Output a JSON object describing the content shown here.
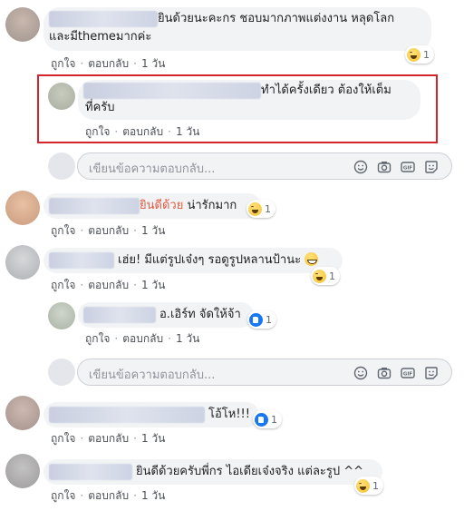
{
  "comments": [
    {
      "text_1": "ยินด้วยนะคะกร ชอบมากภาพแต่งงาน หลุดโลก",
      "text_2": "และมีthemeมากค่ะ",
      "like": "ถูกใจ",
      "reply": "ตอบกลับ",
      "time": "1 วัน",
      "reaction_count": "1"
    },
    {
      "text_1": "ทำได้ครั้งเดียว ต้องให้เต็ม",
      "text_2": "ที่ครับ",
      "like": "ถูกใจ",
      "reply": "ตอบกลับ",
      "time": "1 วัน"
    },
    {
      "text_highlight": "ยินดีด้วย",
      "text_1": "น่ารักมาก",
      "like": "ถูกใจ",
      "reply": "ตอบกลับ",
      "time": "1 วัน",
      "reaction_count": "1"
    },
    {
      "text_1": "เฮ่ย! มีแต่รูปเจ๋งๆ รอดูรูปหลานป้านะ",
      "like": "ถูกใจ",
      "reply": "ตอบกลับ",
      "time": "1 วัน",
      "reaction_count": "1"
    },
    {
      "text_1": "อ.เอิร์ท จัดให้จ้า",
      "like": "ถูกใจ",
      "reply": "ตอบกลับ",
      "time": "1 วัน",
      "reaction_count": "1"
    },
    {
      "text_1": "โอ้โห!!!",
      "like": "ถูกใจ",
      "reply": "ตอบกลับ",
      "time": "1 วัน",
      "reaction_count": "1"
    },
    {
      "text_1": "ยินดีด้วยครับพี่กร ไอเดียเจ๋งจริง แต่ละรูป ^^",
      "like": "ถูกใจ",
      "reply": "ตอบกลับ",
      "time": "1 วัน",
      "reaction_count": "1"
    }
  ],
  "reply_box": {
    "placeholder": "เขียนข้อความตอบกลับ..."
  },
  "separator": "·",
  "reply_icons": [
    "smiley-icon",
    "camera-icon",
    "gif-icon",
    "sticker-icon"
  ],
  "colors": {
    "highlight_border": "#d4252b",
    "name_highlight": "#e15b42",
    "like_blue": "#1877f2"
  }
}
